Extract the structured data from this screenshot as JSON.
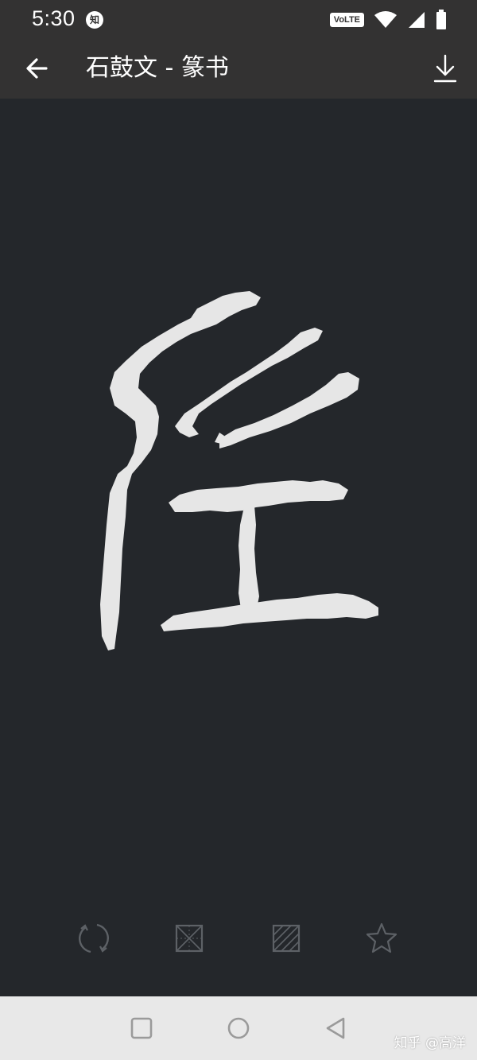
{
  "status_bar": {
    "time": "5:30",
    "notification_badge": "知",
    "network_badge": "VoLTE",
    "icons": [
      "volte-icon",
      "wifi-icon",
      "signal-icon",
      "battery-icon"
    ]
  },
  "toolbar": {
    "title": "石鼓文 - 篆书",
    "back_icon": "arrow-left-icon",
    "download_icon": "download-icon"
  },
  "glyph": {
    "description_icon": "seal-script-glyph"
  },
  "actions": {
    "items": [
      {
        "icon": "rotate-icon"
      },
      {
        "icon": "grid-diagonal-icon"
      },
      {
        "icon": "hatch-icon"
      },
      {
        "icon": "star-icon"
      }
    ]
  },
  "nav_bar": {
    "icons": [
      "square-recents-icon",
      "circle-home-icon",
      "triangle-back-icon"
    ],
    "watermark": "知乎 @高洋"
  },
  "colors": {
    "background": "#24272b",
    "bar": "#333232",
    "glyph": "#e6e6e6",
    "icon_muted": "#5d6166",
    "nav_bar": "#e8e8e8"
  }
}
